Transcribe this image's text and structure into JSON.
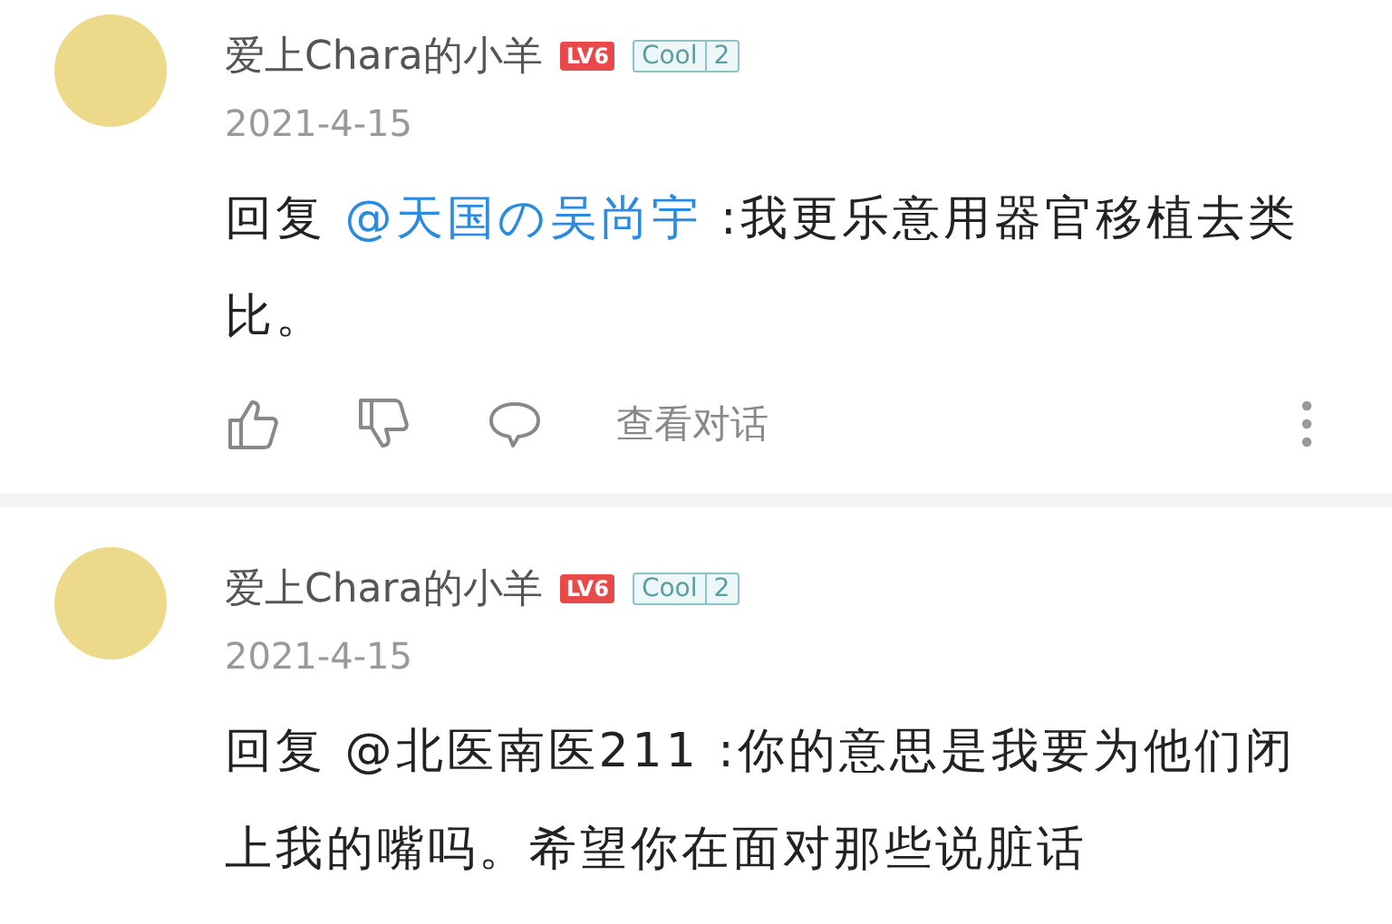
{
  "comments": [
    {
      "author": "爱上Chara的小羊",
      "level_badge": "LV6",
      "fan_badge": {
        "label": "Cool",
        "count": "2"
      },
      "date": "2021-4-15",
      "reply_prefix": "回复",
      "mention": {
        "text": "@天国の吴尚宇",
        "highlighted": true
      },
      "text": ":我更乐意用器官移植去类比。",
      "actions": {
        "view_thread": "查看对话"
      }
    },
    {
      "author": "爱上Chara的小羊",
      "level_badge": "LV6",
      "fan_badge": {
        "label": "Cool",
        "count": "2"
      },
      "date": "2021-4-15",
      "reply_prefix": "回复",
      "mention": {
        "text": "@北医南医211",
        "highlighted": false
      },
      "text": ":你的意思是我要为他们闭上我的嘴吗。希望你在面对那些说脏话"
    }
  ]
}
